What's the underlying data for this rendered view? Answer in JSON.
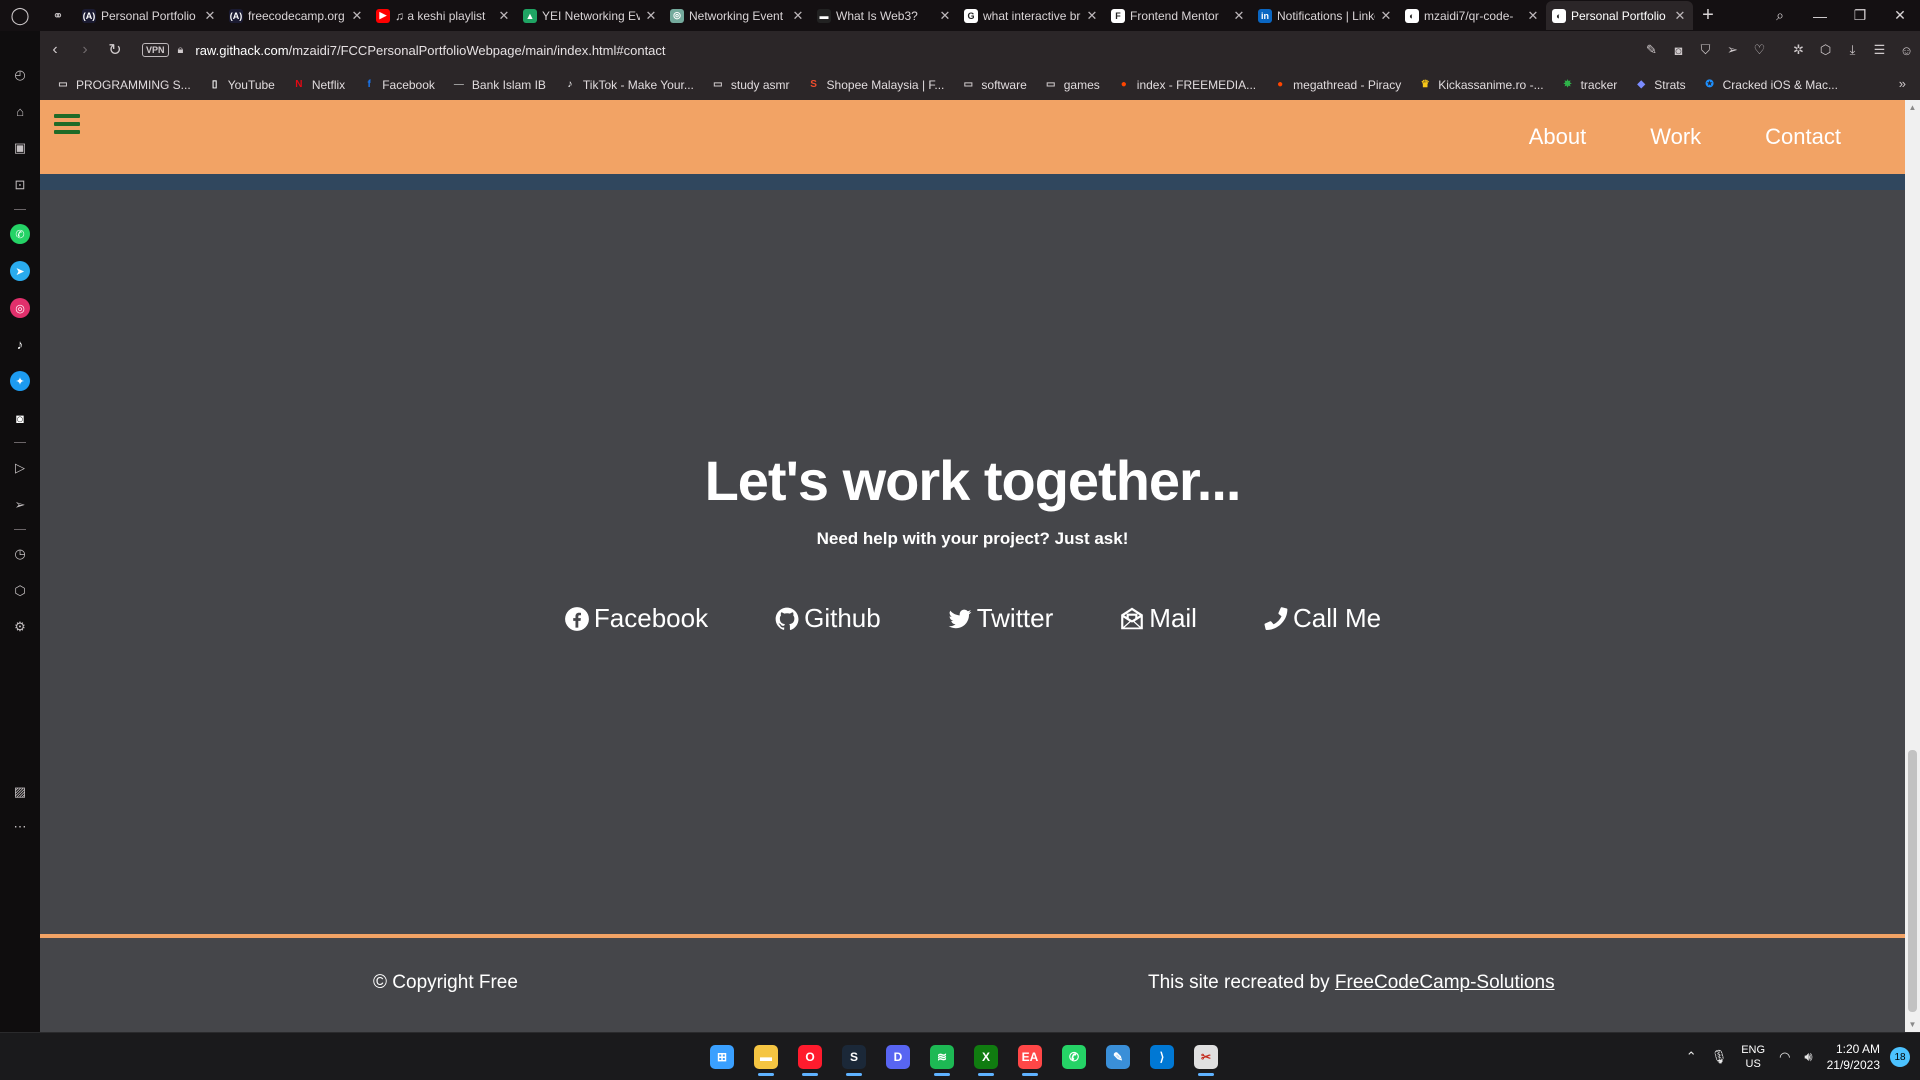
{
  "browser": {
    "tabs": [
      {
        "title": "Personal Portfolio",
        "favicon_color": "#1b1b32",
        "favicon_char": "(A)"
      },
      {
        "title": "freecodecamp.org",
        "favicon_color": "#1b1b32",
        "favicon_char": "(A)"
      },
      {
        "title": "♫ a keshi playlist",
        "favicon_color": "#ff0000",
        "favicon_char": "▶"
      },
      {
        "title": "YEI Networking Event",
        "favicon_color": "#1fa463",
        "favicon_char": "▲"
      },
      {
        "title": "Networking Event",
        "favicon_color": "#74aa9c",
        "favicon_char": "◎"
      },
      {
        "title": "What Is Web3?",
        "favicon_color": "#222222",
        "favicon_char": "▬"
      },
      {
        "title": "what interactive br",
        "favicon_color": "#ffffff",
        "favicon_char": "G"
      },
      {
        "title": "Frontend Mentor",
        "favicon_color": "#ffffff",
        "favicon_char": "F"
      },
      {
        "title": "Notifications | LinkedIn",
        "favicon_color": "#0a66c2",
        "favicon_char": "in"
      },
      {
        "title": "mzaidi7/qr-code-",
        "favicon_color": "#ffffff",
        "favicon_char": "◐"
      },
      {
        "title": "Personal Portfolio",
        "favicon_color": "#ffffff",
        "favicon_char": "◐"
      }
    ],
    "active_tab_index": 10,
    "new_tab_label": "+",
    "url_host": "raw.githack.com",
    "url_path": "/mzaidi7/FCCPersonalPortfolioWebpage/main/index.html#contact",
    "vpn_label": "VPN",
    "bookmarks": [
      {
        "label": "PROGRAMMING S...",
        "icon": "folder-icon",
        "color": "#cfc9cb"
      },
      {
        "label": "YouTube",
        "icon": "page-icon",
        "color": "#ffffff"
      },
      {
        "label": "Netflix",
        "icon": "netflix-icon",
        "color": "#e50914"
      },
      {
        "label": "Facebook",
        "icon": "facebook-icon",
        "color": "#1877f2"
      },
      {
        "label": "Bank Islam IB",
        "icon": "bank-icon",
        "color": "#9a9a9a"
      },
      {
        "label": "TikTok - Make Your...",
        "icon": "tiktok-icon",
        "color": "#ffffff"
      },
      {
        "label": "study asmr",
        "icon": "folder-icon",
        "color": "#cfc9cb"
      },
      {
        "label": "Shopee Malaysia | F...",
        "icon": "shopee-icon",
        "color": "#ee4d2d"
      },
      {
        "label": "software",
        "icon": "folder-icon",
        "color": "#cfc9cb"
      },
      {
        "label": "games",
        "icon": "folder-icon",
        "color": "#cfc9cb"
      },
      {
        "label": "index - FREEMEDIA...",
        "icon": "reddit-icon",
        "color": "#ff4500"
      },
      {
        "label": "megathread - Piracy",
        "icon": "reddit-icon",
        "color": "#ff4500"
      },
      {
        "label": "Kickassanime.ro -...",
        "icon": "crown-icon",
        "color": "#f5c518"
      },
      {
        "label": "tracker",
        "icon": "tracker-icon",
        "color": "#2fb34a"
      },
      {
        "label": "Strats",
        "icon": "diamond-icon",
        "color": "#7b8cff"
      },
      {
        "label": "Cracked iOS & Mac...",
        "icon": "star-badge-icon",
        "color": "#1e90ff"
      }
    ]
  },
  "site": {
    "nav": {
      "links": [
        "About",
        "Work",
        "Contact"
      ]
    },
    "contact": {
      "title": "Let's work together...",
      "subtitle": "Need help with your project? Just ask!",
      "links": [
        {
          "label": "Facebook",
          "icon": "facebook-icon"
        },
        {
          "label": "Github",
          "icon": "github-icon"
        },
        {
          "label": "Twitter",
          "icon": "twitter-icon"
        },
        {
          "label": "Mail",
          "icon": "mail-icon"
        },
        {
          "label": "Call Me",
          "icon": "phone-icon"
        }
      ]
    },
    "footer": {
      "copyright": "© Copyright Free",
      "credit_prefix": "This site recreated by ",
      "credit_link": "FreeCodeCamp-Solutions"
    },
    "colors": {
      "nav_bg": "#f2a365",
      "stripe": "#30475e",
      "body_bg": "#45464a",
      "hamburger": "#1f6b27"
    }
  },
  "taskbar": {
    "apps": [
      {
        "name": "start",
        "icon": "windows-icon",
        "color": "#3aa0ff",
        "char": "⊞",
        "running": false
      },
      {
        "name": "file-explorer",
        "icon": "folder-icon",
        "color": "#f5c542",
        "char": "▬",
        "running": true
      },
      {
        "name": "opera",
        "icon": "opera-icon",
        "color": "#ff1b2d",
        "char": "O",
        "running": true
      },
      {
        "name": "steam",
        "icon": "steam-icon",
        "color": "#1b2838",
        "char": "S",
        "running": true
      },
      {
        "name": "discord",
        "icon": "discord-icon",
        "color": "#5865f2",
        "char": "D",
        "running": false
      },
      {
        "name": "spotify",
        "icon": "spotify-icon",
        "color": "#1db954",
        "char": "≋",
        "running": true
      },
      {
        "name": "xbox",
        "icon": "xbox-icon",
        "color": "#107c10",
        "char": "X",
        "running": true
      },
      {
        "name": "ea",
        "icon": "ea-icon",
        "color": "#ff4747",
        "char": "EA",
        "running": true
      },
      {
        "name": "whatsapp",
        "icon": "whatsapp-icon",
        "color": "#25d366",
        "char": "✆",
        "running": false
      },
      {
        "name": "paint",
        "icon": "paint-icon",
        "color": "#3a8fd8",
        "char": "✎",
        "running": false
      },
      {
        "name": "vscode",
        "icon": "vscode-icon",
        "color": "#0078d4",
        "char": "⟩",
        "running": false
      },
      {
        "name": "snipping-tool",
        "icon": "snip-icon",
        "color": "#e0e0e0",
        "char": "✂",
        "running": true
      }
    ],
    "language": [
      "ENG",
      "US"
    ],
    "time": "1:20 AM",
    "date": "21/9/2023",
    "notification_count": "18"
  }
}
